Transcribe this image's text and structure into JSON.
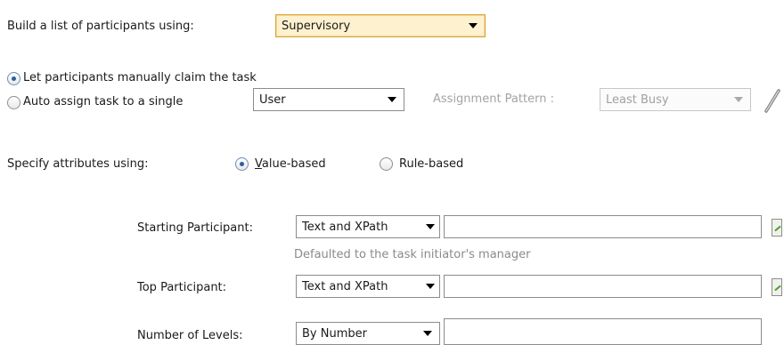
{
  "build_list": {
    "label": "Build a list of participants using:",
    "selected": "Supervisory"
  },
  "assignment": {
    "manual_claim_label": "Let participants manually claim the task",
    "manual_claim_selected": true,
    "auto_assign_label": "Auto assign task to a single",
    "auto_assign_selected": false,
    "auto_assign_type": "User",
    "pattern_label": "Assignment Pattern :",
    "pattern_value": "Least Busy",
    "edit_icon": "pencil-icon"
  },
  "attributes": {
    "label": "Specify attributes using:",
    "value_based_mnemonic": "V",
    "value_based_rest": "alue-based",
    "value_based_selected": true,
    "rule_based_label": "Rule-based",
    "rule_based_selected": false
  },
  "starting_participant": {
    "label": "Starting Participant:",
    "type": "Text and XPath",
    "value": "",
    "hint": "Defaulted to the task initiator's manager"
  },
  "top_participant": {
    "label": "Top Participant:",
    "type": "Text and XPath",
    "value": ""
  },
  "levels": {
    "label": "Number of Levels:",
    "type": "By Number",
    "value": ""
  },
  "colors": {
    "highlight_bg": "#fef1cf",
    "highlight_border": "#d9a23f",
    "disabled_text": "#a0a0a0",
    "radio_dot": "#2d5f9e"
  }
}
